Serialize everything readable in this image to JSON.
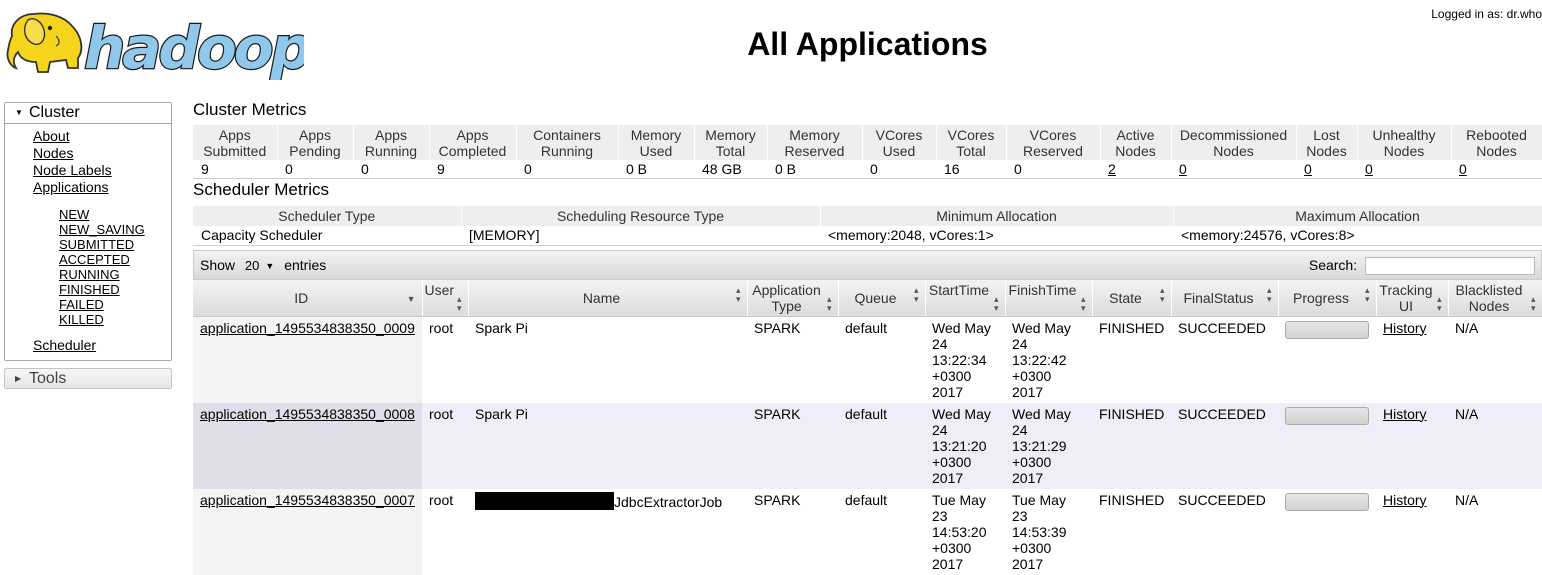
{
  "header": {
    "logo_text": "hadoop",
    "title": "All Applications",
    "user_status": "Logged in as: dr.who"
  },
  "nav": {
    "cluster": {
      "label": "Cluster",
      "links": [
        "About",
        "Nodes",
        "Node Labels",
        "Applications"
      ],
      "app_states": [
        "NEW",
        "NEW_SAVING",
        "SUBMITTED",
        "ACCEPTED",
        "RUNNING",
        "FINISHED",
        "FAILED",
        "KILLED"
      ],
      "scheduler": "Scheduler"
    },
    "tools": {
      "label": "Tools"
    }
  },
  "cluster_metrics": {
    "title": "Cluster Metrics",
    "headers": [
      "Apps Submitted",
      "Apps Pending",
      "Apps Running",
      "Apps Completed",
      "Containers Running",
      "Memory Used",
      "Memory Total",
      "Memory Reserved",
      "VCores Used",
      "VCores Total",
      "VCores Reserved",
      "Active Nodes",
      "Decommissioned Nodes",
      "Lost Nodes",
      "Unhealthy Nodes",
      "Rebooted Nodes"
    ],
    "values": [
      "9",
      "0",
      "0",
      "9",
      "0",
      "0 B",
      "48 GB",
      "0 B",
      "0",
      "16",
      "0",
      "2",
      "0",
      "0",
      "0",
      "0"
    ]
  },
  "scheduler_metrics": {
    "title": "Scheduler Metrics",
    "headers": [
      "Scheduler Type",
      "Scheduling Resource Type",
      "Minimum Allocation",
      "Maximum Allocation"
    ],
    "values": [
      "Capacity Scheduler",
      "[MEMORY]",
      "<memory:2048, vCores:1>",
      "<memory:24576, vCores:8>"
    ]
  },
  "apps_table": {
    "show_label": "Show",
    "length_value": "20",
    "entries_label": "entries",
    "search_label": "Search:",
    "search_value": "",
    "headers": [
      "ID",
      "User",
      "Name",
      "Application Type",
      "Queue",
      "StartTime",
      "FinishTime",
      "State",
      "FinalStatus",
      "Progress",
      "Tracking UI",
      "Blacklisted Nodes"
    ],
    "rows": [
      {
        "id": "application_1495534838350_0009",
        "user": "root",
        "name": "Spark Pi",
        "type": "SPARK",
        "queue": "default",
        "start": "Wed May 24 13:22:34 +0300 2017",
        "finish": "Wed May 24 13:22:42 +0300 2017",
        "state": "FINISHED",
        "final_status": "SUCCEEDED",
        "progress_percent": 100,
        "tracking": "History",
        "blacklisted": "N/A"
      },
      {
        "id": "application_1495534838350_0008",
        "user": "root",
        "name": "Spark Pi",
        "type": "SPARK",
        "queue": "default",
        "start": "Wed May 24 13:21:20 +0300 2017",
        "finish": "Wed May 24 13:21:29 +0300 2017",
        "state": "FINISHED",
        "final_status": "SUCCEEDED",
        "progress_percent": 100,
        "tracking": "History",
        "blacklisted": "N/A"
      },
      {
        "id": "application_1495534838350_0007",
        "user": "root",
        "name": "JdbcExtractorJob",
        "name_redacted": true,
        "type": "SPARK",
        "queue": "default",
        "start": "Tue May 23 14:53:20 +0300 2017",
        "finish": "Tue May 23 14:53:39 +0300 2017",
        "state": "FINISHED",
        "final_status": "SUCCEEDED",
        "progress_percent": 100,
        "tracking": "History",
        "blacklisted": "N/A"
      }
    ]
  },
  "colors": {
    "logo_yellow": "#f5d41c",
    "logo_blue": "#8fc8ea",
    "row_even": "#eeeef8",
    "header_gray": "#eeeeee"
  }
}
